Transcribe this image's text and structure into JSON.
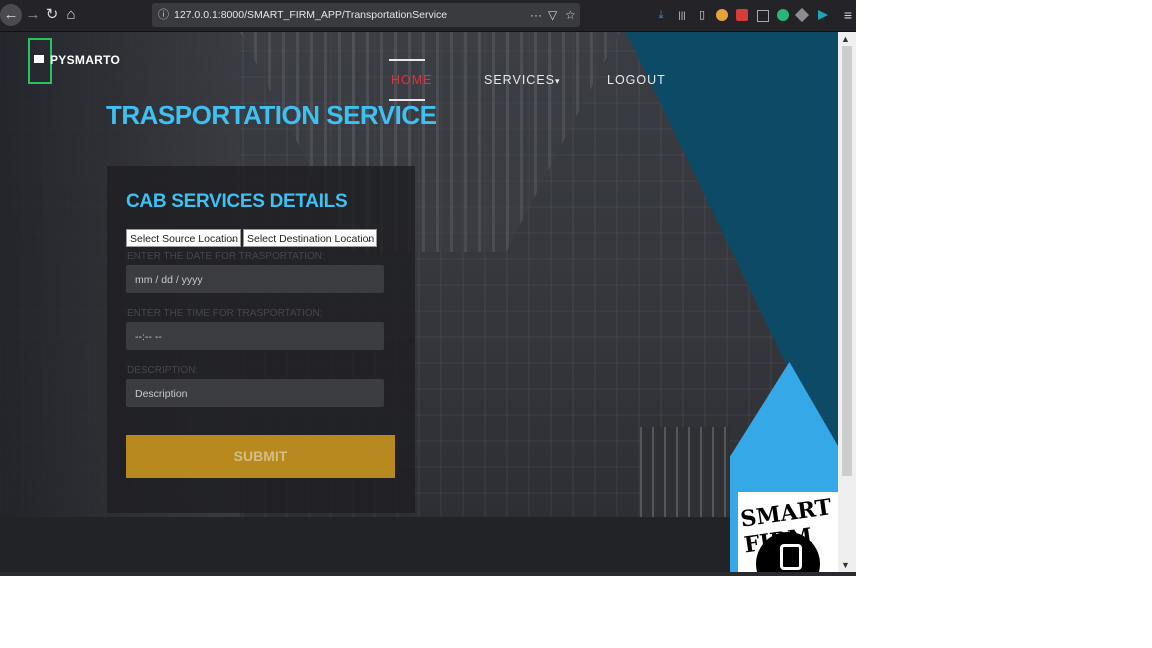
{
  "browser": {
    "url": "127.0.0.1:8000/SMART_FIRM_APP/TransportationService",
    "nav_icons": [
      "back-icon",
      "forward-icon",
      "reload-icon",
      "home-icon"
    ],
    "url_icons": [
      "info-icon",
      "more-icon",
      "pocket-icon",
      "bookmark-star-icon"
    ],
    "toolbar_icons": [
      "download-icon",
      "library-icon",
      "sidebar-icon",
      "extension-icon",
      "extension-icon",
      "extension-icon",
      "extension-icon",
      "extension-icon",
      "extension-icon",
      "menu-icon"
    ],
    "glyphs": {
      "back": "←",
      "forward": "→",
      "reload": "↻",
      "home": "⌂",
      "info": "ⓘ",
      "more": "···",
      "pocket": "▽",
      "star": "☆",
      "download": "⤓",
      "library": "|||",
      "sidebar": "▯",
      "menu": "≡"
    },
    "accent_color": "#2a6ad6"
  },
  "navbar": {
    "brand": "PYSMARTO",
    "links": [
      "HOME",
      "SERVICES",
      "LOGOUT"
    ],
    "services_caret": "▾",
    "active_color": "#e0343b"
  },
  "page_title": "TRASPORTATION SERVICE",
  "form": {
    "heading": "CAB SERVICES DETAILS",
    "source_select": {
      "value": "Select Source Location",
      "chevron": "⌄"
    },
    "destination_select": {
      "value": "Select Destination Location",
      "chevron": "⌄"
    },
    "date_label": "ENTER THE DATE FOR TRASPORTATION:",
    "date_value": "mm / dd / yyyy",
    "time_label": "ENTER THE TIME FOR TRASPORTATION:",
    "time_value": "--:-- --",
    "description_label": "DESCRIPTION:",
    "description_placeholder": "Description",
    "submit_label": "SUBMIT",
    "submit_color": "#b8891f"
  },
  "badge": {
    "text": "SMART FIRM"
  },
  "colors": {
    "title": "#3ec0f0",
    "teal_panel": "#0c4a66",
    "sky_panel": "#35a8e8",
    "logo_border": "#22c55e"
  },
  "scrollbar": {
    "up": "▲",
    "down": "▼"
  }
}
